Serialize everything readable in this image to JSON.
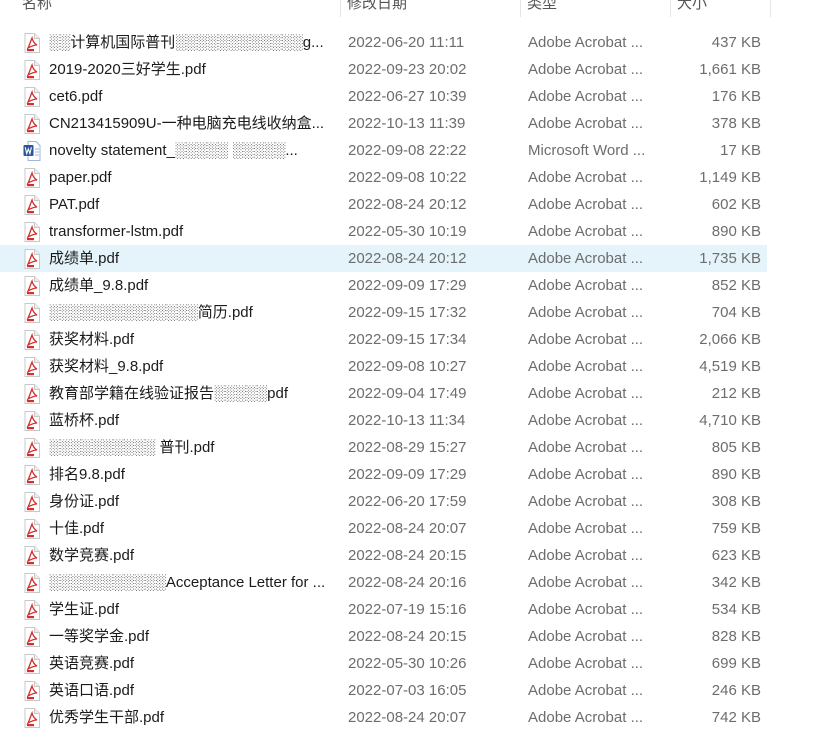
{
  "header": {
    "name": "名称",
    "date": "修改日期",
    "type": "类型",
    "size": "大小"
  },
  "colors": {
    "selected_row": "#e5f3fb",
    "pdf_red": "#d32f2f",
    "word_blue": "#2b579a"
  },
  "files": [
    {
      "name": "░░计算机国际普刊░░░░░░░░░░░░g...",
      "date": "2022-06-20 11:11",
      "type": "Adobe Acrobat ...",
      "size": "437 KB",
      "icon": "pdf-icon"
    },
    {
      "name": "2019-2020三好学生.pdf",
      "date": "2022-09-23 20:02",
      "type": "Adobe Acrobat ...",
      "size": "1,661 KB",
      "icon": "pdf-icon"
    },
    {
      "name": "cet6.pdf",
      "date": "2022-06-27 10:39",
      "type": "Adobe Acrobat ...",
      "size": "176 KB",
      "icon": "pdf-icon"
    },
    {
      "name": "CN213415909U-一种电脑充电线收纳盒...",
      "date": "2022-10-13 11:39",
      "type": "Adobe Acrobat ...",
      "size": "378 KB",
      "icon": "pdf-icon"
    },
    {
      "name": "novelty statement_░░░░░ ░░░░░...",
      "date": "2022-09-08 22:22",
      "type": "Microsoft Word ...",
      "size": "17 KB",
      "icon": "word-icon"
    },
    {
      "name": "paper.pdf",
      "date": "2022-09-08 10:22",
      "type": "Adobe Acrobat ...",
      "size": "1,149 KB",
      "icon": "pdf-icon"
    },
    {
      "name": "PAT.pdf",
      "date": "2022-08-24 20:12",
      "type": "Adobe Acrobat ...",
      "size": "602 KB",
      "icon": "pdf-icon"
    },
    {
      "name": "transformer-lstm.pdf",
      "date": "2022-05-30 10:19",
      "type": "Adobe Acrobat ...",
      "size": "890 KB",
      "icon": "pdf-icon"
    },
    {
      "name": "成绩单.pdf",
      "date": "2022-08-24 20:12",
      "type": "Adobe Acrobat ...",
      "size": "1,735 KB",
      "icon": "pdf-icon",
      "selected": true
    },
    {
      "name": "成绩单_9.8.pdf",
      "date": "2022-09-09 17:29",
      "type": "Adobe Acrobat ...",
      "size": "852 KB",
      "icon": "pdf-icon"
    },
    {
      "name": "░░░░░░░░░░░░░░简历.pdf",
      "date": "2022-09-15 17:32",
      "type": "Adobe Acrobat ...",
      "size": "704 KB",
      "icon": "pdf-icon"
    },
    {
      "name": "获奖材料.pdf",
      "date": "2022-09-15 17:34",
      "type": "Adobe Acrobat ...",
      "size": "2,066 KB",
      "icon": "pdf-icon"
    },
    {
      "name": "获奖材料_9.8.pdf",
      "date": "2022-09-08 10:27",
      "type": "Adobe Acrobat ...",
      "size": "4,519 KB",
      "icon": "pdf-icon"
    },
    {
      "name": "教育部学籍在线验证报告░░░░░pdf",
      "date": "2022-09-04 17:49",
      "type": "Adobe Acrobat ...",
      "size": "212 KB",
      "icon": "pdf-icon"
    },
    {
      "name": "蓝桥杯.pdf",
      "date": "2022-10-13 11:34",
      "type": "Adobe Acrobat ...",
      "size": "4,710 KB",
      "icon": "pdf-icon"
    },
    {
      "name": "░░░░░░░░░░ 普刊.pdf",
      "date": "2022-08-29 15:27",
      "type": "Adobe Acrobat ...",
      "size": "805 KB",
      "icon": "pdf-icon"
    },
    {
      "name": "排名9.8.pdf",
      "date": "2022-09-09 17:29",
      "type": "Adobe Acrobat ...",
      "size": "890 KB",
      "icon": "pdf-icon"
    },
    {
      "name": "身份证.pdf",
      "date": "2022-06-20 17:59",
      "type": "Adobe Acrobat ...",
      "size": "308 KB",
      "icon": "pdf-icon"
    },
    {
      "name": "十佳.pdf",
      "date": "2022-08-24 20:07",
      "type": "Adobe Acrobat ...",
      "size": "759 KB",
      "icon": "pdf-icon"
    },
    {
      "name": "数学竞赛.pdf",
      "date": "2022-08-24 20:15",
      "type": "Adobe Acrobat ...",
      "size": "623 KB",
      "icon": "pdf-icon"
    },
    {
      "name": "░░░░░░░░░░░Acceptance Letter for ...",
      "date": "2022-08-24 20:16",
      "type": "Adobe Acrobat ...",
      "size": "342 KB",
      "icon": "pdf-icon"
    },
    {
      "name": "学生证.pdf",
      "date": "2022-07-19 15:16",
      "type": "Adobe Acrobat ...",
      "size": "534 KB",
      "icon": "pdf-icon"
    },
    {
      "name": "一等奖学金.pdf",
      "date": "2022-08-24 20:15",
      "type": "Adobe Acrobat ...",
      "size": "828 KB",
      "icon": "pdf-icon"
    },
    {
      "name": "英语竞赛.pdf",
      "date": "2022-05-30 10:26",
      "type": "Adobe Acrobat ...",
      "size": "699 KB",
      "icon": "pdf-icon"
    },
    {
      "name": "英语口语.pdf",
      "date": "2022-07-03 16:05",
      "type": "Adobe Acrobat ...",
      "size": "246 KB",
      "icon": "pdf-icon"
    },
    {
      "name": "优秀学生干部.pdf",
      "date": "2022-08-24 20:07",
      "type": "Adobe Acrobat ...",
      "size": "742 KB",
      "icon": "pdf-icon"
    }
  ]
}
